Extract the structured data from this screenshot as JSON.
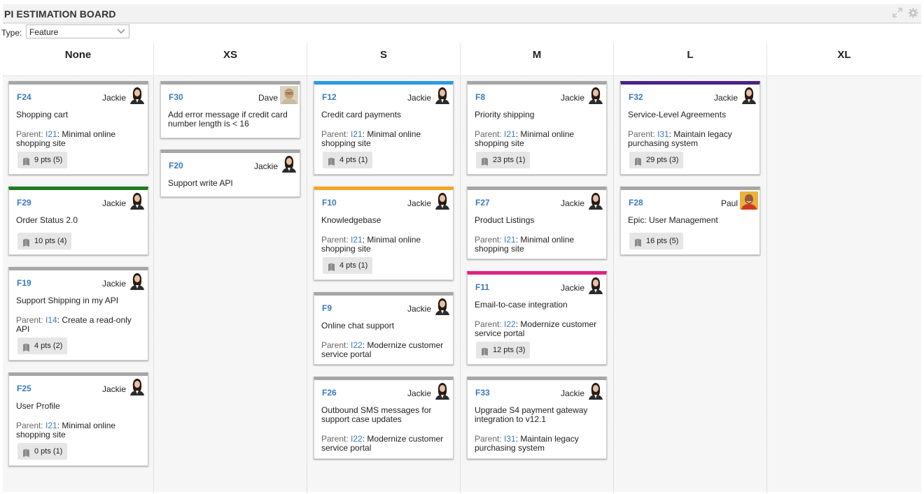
{
  "board": {
    "title": "PI ESTIMATION BOARD"
  },
  "filter": {
    "label": "Type:",
    "selected": "Feature"
  },
  "columns": [
    "None",
    "XS",
    "S",
    "M",
    "L",
    "XL"
  ],
  "cards": {
    "F24": {
      "id": "F24",
      "owner": "Jackie",
      "title": "Shopping cart",
      "parent_label": "Parent:",
      "parent_id": "I21",
      "parent_name": ": Minimal online shopping site",
      "points": "9 pts (5)"
    },
    "F29": {
      "id": "F29",
      "owner": "Jackie",
      "title": "Order Status 2.0",
      "points": "10 pts (4)"
    },
    "F19": {
      "id": "F19",
      "owner": "Jackie",
      "title": "Support Shipping in my API",
      "parent_label": "Parent:",
      "parent_id": "I14",
      "parent_name": ": Create a read-only API",
      "points": "4 pts (2)"
    },
    "F25": {
      "id": "F25",
      "owner": "Jackie",
      "title": "User Profile",
      "parent_label": "Parent:",
      "parent_id": "I21",
      "parent_name": ": Minimal online shopping site",
      "points": "0 pts (1)"
    },
    "F30": {
      "id": "F30",
      "owner": "Dave",
      "title": "Add error message if credit card number length is < 16"
    },
    "F20": {
      "id": "F20",
      "owner": "Jackie",
      "title": "Support write API"
    },
    "F12": {
      "id": "F12",
      "owner": "Jackie",
      "title": "Credit card payments",
      "parent_label": "Parent:",
      "parent_id": "I21",
      "parent_name": ": Minimal online shopping site",
      "points": "4 pts (1)"
    },
    "F10": {
      "id": "F10",
      "owner": "Jackie",
      "title": "Knowledgebase",
      "parent_label": "Parent:",
      "parent_id": "I21",
      "parent_name": ": Minimal online shopping site",
      "points": "4 pts (1)"
    },
    "F9": {
      "id": "F9",
      "owner": "Jackie",
      "title": "Online chat support",
      "parent_label": "Parent:",
      "parent_id": "I22",
      "parent_name": ": Modernize customer service portal"
    },
    "F26": {
      "id": "F26",
      "owner": "Jackie",
      "title": "Outbound SMS messages for support case updates",
      "parent_label": "Parent:",
      "parent_id": "I22",
      "parent_name": ": Modernize customer service portal"
    },
    "F8": {
      "id": "F8",
      "owner": "Jackie",
      "title": "Priority shipping",
      "parent_label": "Parent:",
      "parent_id": "I21",
      "parent_name": ": Minimal online shopping site",
      "points": "23 pts (1)"
    },
    "F27": {
      "id": "F27",
      "owner": "Jackie",
      "title": "Product Listings",
      "parent_label": "Parent:",
      "parent_id": "I21",
      "parent_name": ": Minimal online shopping site"
    },
    "F11": {
      "id": "F11",
      "owner": "Jackie",
      "title": "Email-to-case integration",
      "parent_label": "Parent:",
      "parent_id": "I22",
      "parent_name": ": Modernize customer service portal",
      "points": "12 pts (3)"
    },
    "F33": {
      "id": "F33",
      "owner": "Jackie",
      "title": "Upgrade S4 payment gateway integration to v12.1",
      "parent_label": "Parent:",
      "parent_id": "I31",
      "parent_name": ": Maintain legacy purchasing system"
    },
    "F32": {
      "id": "F32",
      "owner": "Jackie",
      "title": "Service-Level Agreements",
      "parent_label": "Parent:",
      "parent_id": "I31",
      "parent_name": ": Maintain legacy purchasing system",
      "points": "29 pts (3)"
    },
    "F28": {
      "id": "F28",
      "owner": "Paul",
      "title": "Epic: User Management",
      "points": "16 pts (5)"
    }
  },
  "colors": {
    "default_stripe": "#a6a6a6",
    "green_stripe": "#1e7b1e",
    "blue_stripe": "#2b9be0",
    "orange_stripe": "#f5a623",
    "magenta_stripe": "#e0227f",
    "purple_stripe": "#4a2384",
    "link": "#3a7ac2"
  }
}
